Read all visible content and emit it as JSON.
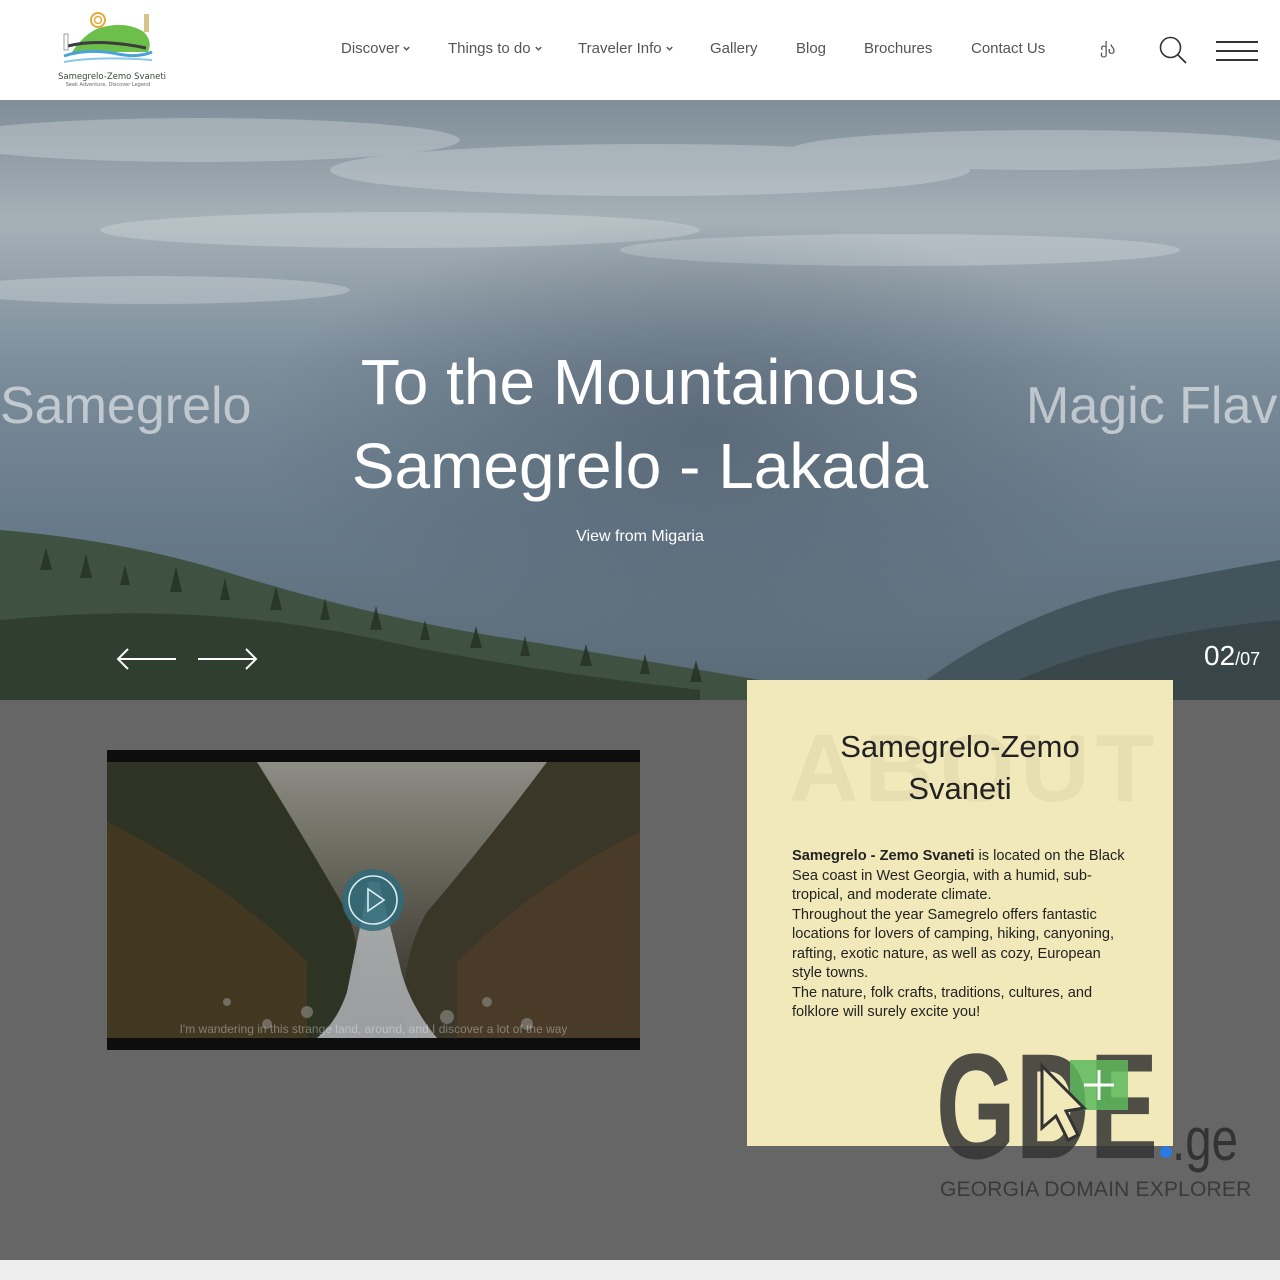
{
  "brand": {
    "name": "Samegrelo-Zemo Svaneti",
    "tagline": "Seek Adventure, Discover Legend"
  },
  "nav": {
    "items": [
      {
        "label": "Discover",
        "has_dropdown": true
      },
      {
        "label": "Things to do",
        "has_dropdown": true
      },
      {
        "label": "Traveler Info",
        "has_dropdown": true
      },
      {
        "label": "Gallery",
        "has_dropdown": false
      },
      {
        "label": "Blog",
        "has_dropdown": false
      },
      {
        "label": "Brochures",
        "has_dropdown": false
      },
      {
        "label": "Contact Us",
        "has_dropdown": false
      }
    ],
    "language": "ქა",
    "search_icon": "search-icon",
    "menu_icon": "hamburger-icon"
  },
  "hero": {
    "title": "To the Mountainous Samegrelo - Lakada",
    "subtitle": "View from Migaria",
    "prev_slide_peek": "Samegrelo",
    "next_slide_peek": "Magic Flav",
    "current_slide": "02",
    "total_slides": "/07",
    "prev_icon": "arrow-left-icon",
    "next_icon": "arrow-right-icon"
  },
  "video": {
    "caption": "I'm wandering in this strange land, around, and I discover a lot of the way",
    "play_icon": "play-icon"
  },
  "about": {
    "background_word": "ABOUT",
    "title": "Samegrelo-Zemo Svaneti",
    "lead_bold": "Samegrelo - Zemo Svaneti",
    "lead_rest": " is located on the Black Sea coast in West Georgia, with a humid, sub-tropical, and moderate climate.",
    "paragraph2": "Throughout the year Samegrelo offers fantastic locations for lovers of camping, hiking, canyoning, rafting, exotic nature, as well as cozy, European style towns.",
    "paragraph3": "The nature, folk crafts, traditions, cultures, and folklore will surely excite you!"
  },
  "watermark": {
    "logo_text": "GDE",
    "domain": ".ge",
    "tagline": "GEORGIA DOMAIN EXPLORER"
  },
  "colors": {
    "header_bg": "#ffffff",
    "band_bg": "#666666",
    "card_bg": "#f1e9b9",
    "accent_green": "#5cb85c",
    "accent_blue": "#2a7ae2"
  }
}
